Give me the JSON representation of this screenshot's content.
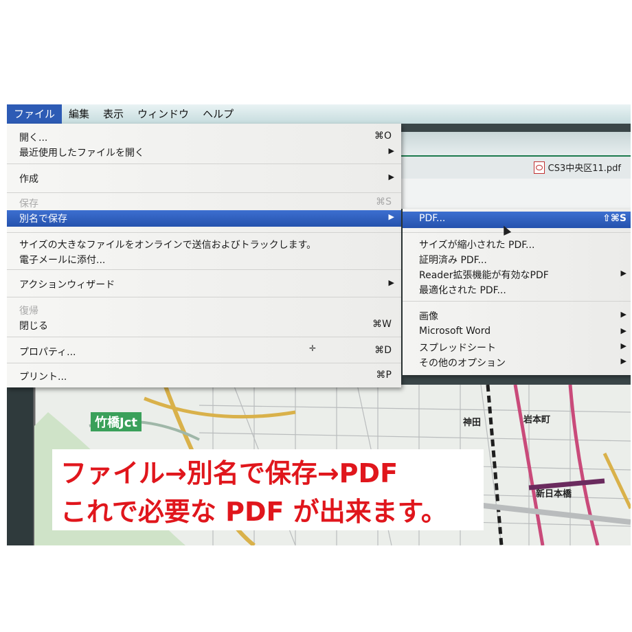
{
  "menubar": {
    "items": [
      "ファイル",
      "編集",
      "表示",
      "ウィンドウ",
      "ヘルプ"
    ]
  },
  "tab": {
    "filename": "CS3中央区11.pdf"
  },
  "file_menu": {
    "open": {
      "label": "開く...",
      "shortcut": "⌘O"
    },
    "recent": {
      "label": "最近使用したファイルを開く"
    },
    "create": {
      "label": "作成"
    },
    "save": {
      "label": "保存",
      "shortcut": "⌘S"
    },
    "save_as": {
      "label": "別名で保存"
    },
    "send_track": {
      "label": "サイズの大きなファイルをオンラインで送信およびトラックします。"
    },
    "email": {
      "label": "電子メールに添付..."
    },
    "action_wizard": {
      "label": "アクションウィザード"
    },
    "revert": {
      "label": "復帰"
    },
    "close": {
      "label": "閉じる",
      "shortcut": "⌘W"
    },
    "properties": {
      "label": "プロパティ...",
      "shortcut": "⌘D"
    },
    "print": {
      "label": "プリント...",
      "shortcut": "⌘P"
    }
  },
  "save_as_submenu": {
    "pdf": {
      "label": "PDF...",
      "shortcut": "⇧⌘S"
    },
    "reduced": {
      "label": "サイズが縮小された PDF..."
    },
    "certified": {
      "label": "証明済み PDF..."
    },
    "reader_ext": {
      "label": "Reader拡張機能が有効なPDF"
    },
    "optimized": {
      "label": "最適化された PDF..."
    },
    "image": {
      "label": "画像"
    },
    "word": {
      "label": "Microsoft Word"
    },
    "spreadsheet": {
      "label": "スプレッドシート"
    },
    "other": {
      "label": "その他のオプション"
    }
  },
  "map_labels": {
    "jct": "竹橋Jct",
    "kanda": "神田",
    "iwamoto": "岩本町",
    "shin_nihonbashi": "新日本橋"
  },
  "caption": {
    "line1": "ファイル→別名で保存→PDF",
    "line2": "これで必要な PDF が出来ます。"
  },
  "colors": {
    "highlight": "#2d5bb5",
    "caption_red": "#e0161c",
    "jct_green": "#3aa05a"
  }
}
